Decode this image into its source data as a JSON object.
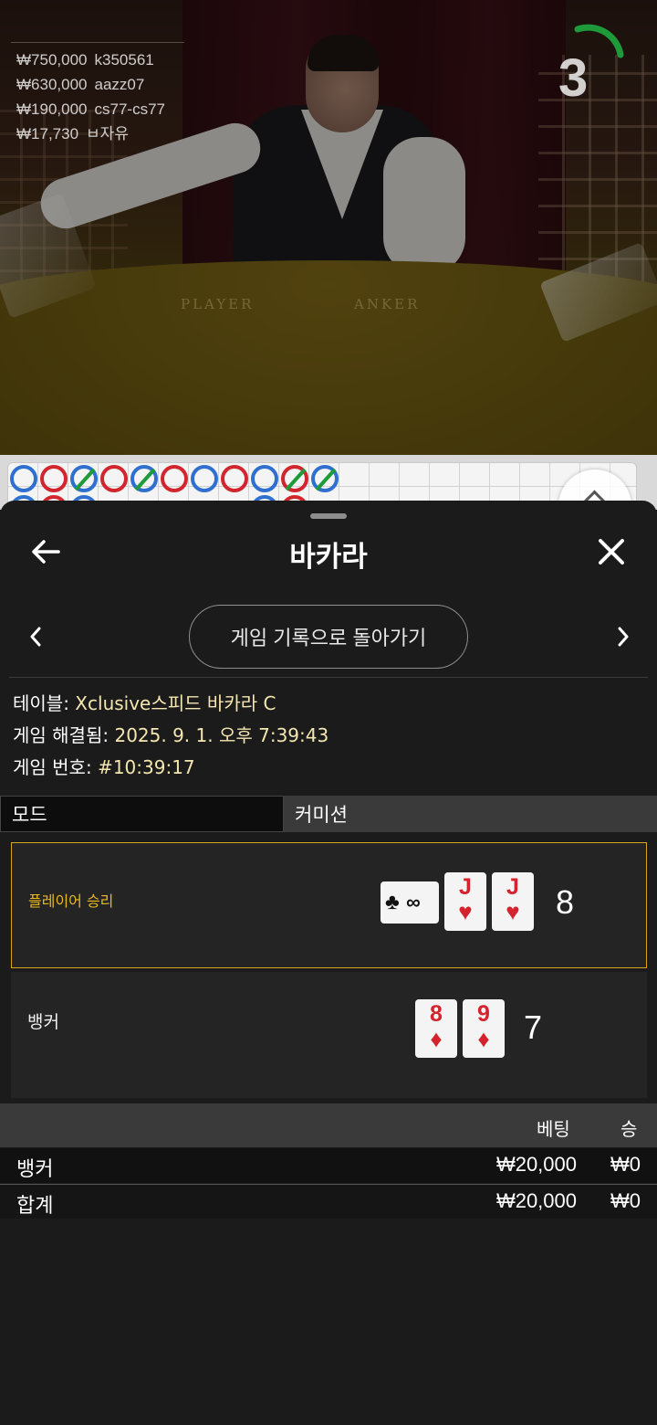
{
  "video": {
    "felt_player": "PLAYER",
    "felt_banker": "ANKER",
    "countdown": "3",
    "leaderboard": [
      {
        "amount": "₩750,000",
        "user": "k350561"
      },
      {
        "amount": "₩630,000",
        "user": "aazz07"
      },
      {
        "amount": "₩190,000",
        "user": "cs77-cs77"
      },
      {
        "amount": "₩17,730",
        "user": "ㅂ자유"
      }
    ]
  },
  "sheet": {
    "title": "바카라",
    "return_label": "게임 기록으로 돌아가기",
    "info": {
      "table_key": "테이블:",
      "table_value": " Xclusive스피드 바카라 C",
      "resolved_key": "게임 해결됨:",
      "resolved_value": " 2025. 9. 1. 오후 7:39:43",
      "number_key": "게임 번호:",
      "number_value": " #10:39:17"
    },
    "mode": {
      "left": "모드",
      "right": "커미션"
    },
    "player": {
      "label": "플레이어 승리",
      "score": "8",
      "cards": [
        {
          "rank": "∞",
          "suit": "♣"
        },
        {
          "rank": "J",
          "suit": "♥"
        },
        {
          "rank": "J",
          "suit": "♥"
        }
      ]
    },
    "banker": {
      "label": "뱅커",
      "score": "7",
      "cards": [
        {
          "rank": "8",
          "suit": "♦"
        },
        {
          "rank": "9",
          "suit": "♦"
        }
      ]
    },
    "bets": {
      "col_bet": "베팅",
      "col_win": "승",
      "rows": [
        {
          "name": "뱅커",
          "bet": "₩20,000",
          "win": "₩0"
        },
        {
          "name": "합계",
          "bet": "₩20,000",
          "win": "₩0"
        }
      ]
    }
  },
  "colors": {
    "accent_gold": "#d4a71e",
    "win_text": "#e9b91f",
    "card_red": "#d5232e",
    "timer_green": "#1e9a3b"
  },
  "icons": {
    "back": "arrow-left-icon",
    "close": "close-icon",
    "prev": "chevron-left-icon",
    "next": "chevron-right-icon"
  }
}
